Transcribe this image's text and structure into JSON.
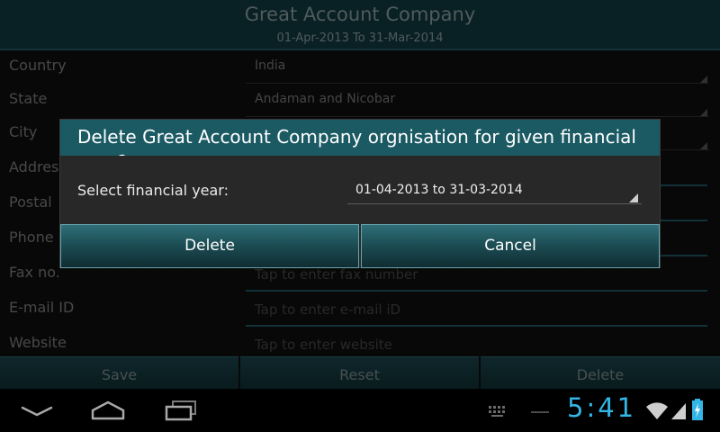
{
  "header": {
    "title": "Great Account Company",
    "subtitle": "01-Apr-2013 To 31-Mar-2014"
  },
  "form": {
    "country": {
      "label": "Country",
      "value": "India"
    },
    "state": {
      "label": "State",
      "value": "Andaman and Nicobar"
    },
    "city": {
      "label": "City"
    },
    "address": {
      "label": "Address"
    },
    "postal": {
      "label": "Postal"
    },
    "phone": {
      "label": "Phone"
    },
    "fax": {
      "label": "Fax no.",
      "placeholder": "Tap to enter fax number"
    },
    "email": {
      "label": "E-mail ID",
      "placeholder": "Tap to enter e-mail iD"
    },
    "website": {
      "label": "Website",
      "placeholder": "Tap to enter website"
    }
  },
  "actions": {
    "save": "Save",
    "reset": "Reset",
    "delete": "Delete"
  },
  "dialog": {
    "title": "Delete Great Account Company orgnisation for given financial year?",
    "select_label": "Select financial year:",
    "selected_year": "01-04-2013 to 31-03-2014",
    "delete_label": "Delete",
    "cancel_label": "Cancel"
  },
  "status": {
    "time": "5:41"
  },
  "colors": {
    "accent": "#33b5e5",
    "dialog_title_bg": "#1b5a63",
    "field_underline": "#1b4e58"
  },
  "icons": [
    "back-icon",
    "home-icon",
    "recent-apps-icon",
    "keyboard-icon",
    "wifi-icon",
    "signal-icon",
    "battery-icon"
  ]
}
